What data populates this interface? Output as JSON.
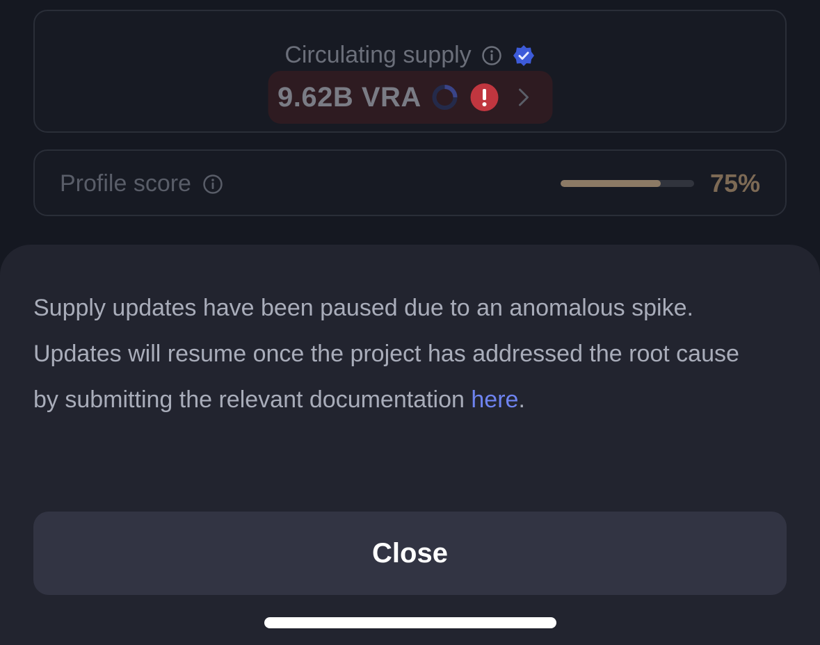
{
  "supply_card": {
    "label": "Circulating supply",
    "value": "9.62B VRA",
    "icons": [
      "info-icon",
      "verified-badge-icon",
      "loading-spinner-icon",
      "alert-icon",
      "chevron-right-icon"
    ]
  },
  "profile_card": {
    "label": "Profile score",
    "progress": 0.75,
    "progress_text": "75%",
    "icons": [
      "info-icon"
    ]
  },
  "sheet": {
    "message": "Supply updates have been paused due to an anomalous spike. Updates will resume once the project has addressed the root cause by submitting the relevant documentation ",
    "link_text": "here",
    "message_end": ".",
    "close_label": "Close"
  },
  "colors": {
    "background": "#151821",
    "sheet": "#22242f",
    "link": "#6e83f0",
    "alert": "#c0363f",
    "verified": "#3d5bd9",
    "progress_fill": "#8c7a65"
  }
}
